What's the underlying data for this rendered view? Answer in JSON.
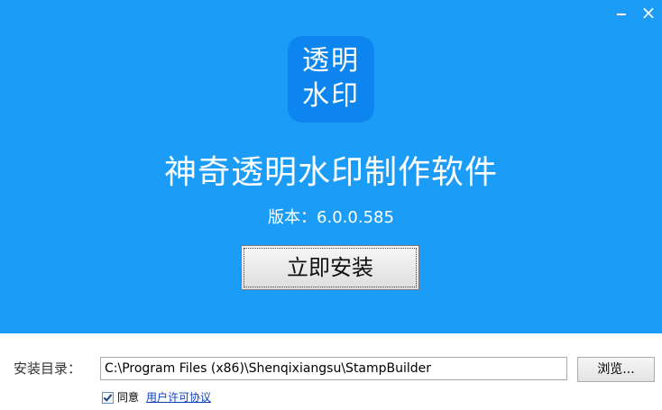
{
  "window": {
    "minimize_icon": "minimize-icon",
    "close_icon": "close-icon",
    "close_glyph": "×"
  },
  "hero": {
    "background_color": "#1a9cf7",
    "logo": {
      "line1": "透明",
      "line2": "水印",
      "color": "#0c86ee"
    },
    "title": "神奇透明水印制作软件",
    "version": "版本：6.0.0.585",
    "install_button": "立即安装"
  },
  "install_dir": {
    "label": "安装目录：",
    "value": "C:\\Program Files (x86)\\Shenqixiangsu\\StampBuilder",
    "browse_button": "浏览..."
  },
  "agreement": {
    "checked": true,
    "text": "同意",
    "link_text": "用户许可协议"
  }
}
